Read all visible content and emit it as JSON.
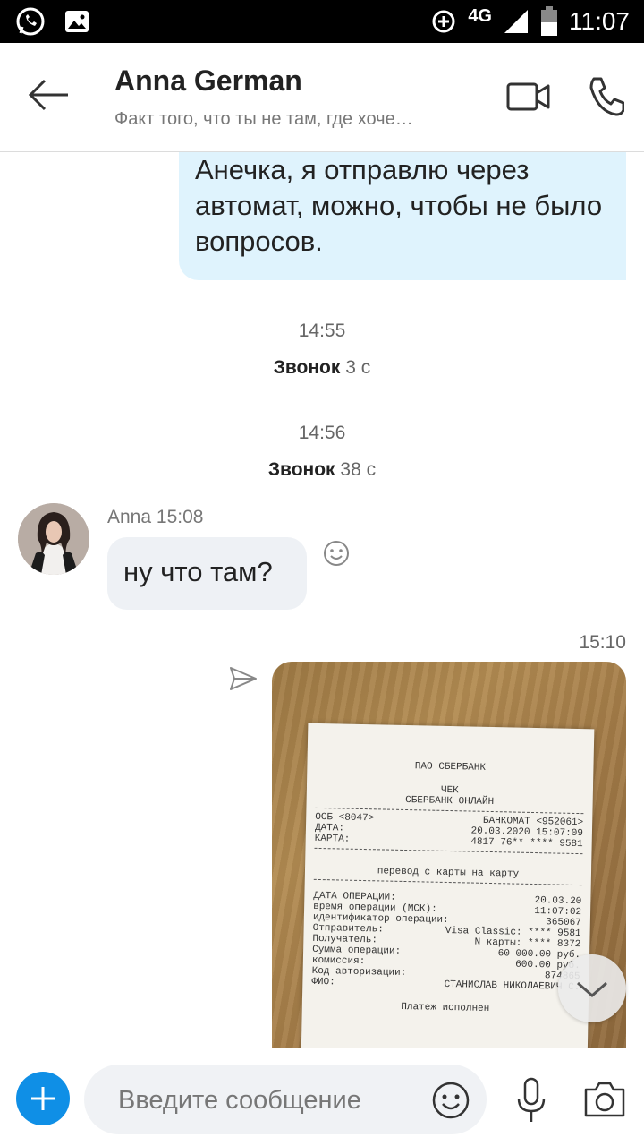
{
  "status_bar": {
    "network": "4G",
    "time": "11:07"
  },
  "header": {
    "contact_name": "Anna German",
    "subtitle": "Факт того, что ты не там, где хоче…"
  },
  "messages": {
    "outgoing_text": "Анечка,  я отправлю через автомат, можно, чтобы не было вопросов.",
    "call1_time": "14:55",
    "call1_label": "Звонок",
    "call1_duration": "3 с",
    "call2_time": "14:56",
    "call2_label": "Звонок",
    "call2_duration": "38 с",
    "incoming_sender": "Anna",
    "incoming_time": "15:08",
    "incoming_text": "ну что там?",
    "photo_time": "15:10"
  },
  "receipt": {
    "bank": "ПАО СБЕРБАНК",
    "type": "ЧЕК",
    "service": "СБЕРБАНК ОНЛАЙН",
    "ose": "ОСБ <8047>",
    "atm": "БАНКОМАТ <952061>",
    "date_label": "ДАТА:",
    "date": "20.03.2020 15:07:09",
    "card_label": "КАРТА:",
    "card": "4817 76** **** 9581",
    "operation": "перевод с карты на карту",
    "op_date_label": "ДАТА ОПЕРАЦИИ:",
    "op_date": "20.03.20",
    "op_time_label": "время операции (МСК):",
    "op_time": "11:07:02",
    "op_id_label": "идентификатор операции:",
    "op_id": "365067",
    "sender_label": "Отправитель:",
    "sender": "Visa Classic: **** 9581",
    "recipient_label": "Получатель:",
    "recipient": "N карты: **** 8372",
    "amount_label": "Сумма операции:",
    "amount": "60 000.00 руб.",
    "fee_label": "комиссия:",
    "fee": "600.00 руб.",
    "auth_label": "Код авторизации:",
    "auth": "874865",
    "fio_label": "ФИО:",
    "fio": "СТАНИСЛАВ НИКОЛАЕВИЧ С.",
    "status": "Платеж исполнен"
  },
  "composer": {
    "placeholder": "Введите сообщение"
  },
  "colors": {
    "accent": "#0f8fe6",
    "outgoing_bubble": "#dff3fd",
    "incoming_bubble": "#eef1f5"
  }
}
